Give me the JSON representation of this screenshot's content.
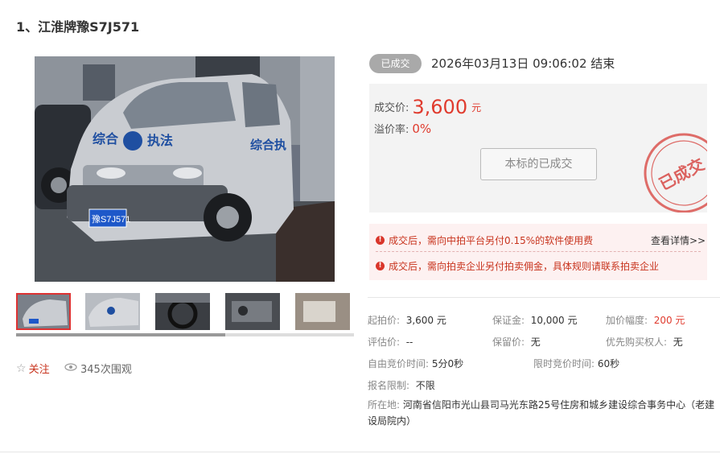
{
  "lot": {
    "title": "1、江淮牌豫S7J571"
  },
  "gallery": {
    "main_image_alt": "vehicle photo",
    "plate_text": "豫S7J571",
    "van_text_left": "综合",
    "van_text_mid": "执法",
    "van_text_side": "综合执"
  },
  "status": {
    "badge": "已成交",
    "end_time": "2026年03月13日  09:06:02 结束"
  },
  "price": {
    "deal_label": "成交价:",
    "deal_value": "3,600",
    "deal_unit": "元",
    "premium_label": "溢价率:",
    "premium_value": "0%",
    "sold_button": "本标的已成交",
    "stamp_text": "已成交"
  },
  "notices": {
    "fee_notice": "成交后，需向中拍平台另付0.15%的软件使用费",
    "detail_link": "查看详情>>",
    "commission_notice": "成交后，需向拍卖企业另付拍卖佣金，具体规则请联系拍卖企业"
  },
  "social": {
    "follow_label": "关注",
    "views": "345次围观"
  },
  "details": {
    "start_price_label": "起拍价:",
    "start_price": "3,600 元",
    "deposit_label": "保证金:",
    "deposit": "10,000 元",
    "increment_label": "加价幅度:",
    "increment": "200 元",
    "appraisal_label": "评估价:",
    "appraisal": "--",
    "reserve_label": "保留价:",
    "reserve": "无",
    "priority_label": "优先购买权人:",
    "priority": "无",
    "free_bid_label": "自由竞价时间:",
    "free_bid": "5分0秒",
    "limited_bid_label": "限时竞价时间:",
    "limited_bid": "60秒",
    "restriction_label": "报名限制:",
    "restriction": "不限",
    "location_label": "所在地:",
    "location": "河南省信阳市光山县司马光东路25号住房和城乡建设综合事务中心（老建设局院内）"
  },
  "colors": {
    "accent_red": "#e03b2e",
    "badge_gray": "#a9a9a9"
  }
}
